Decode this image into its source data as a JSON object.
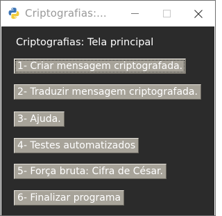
{
  "window": {
    "title": "Criptografias:...",
    "controls": {
      "minimize_icon": "minimize-icon",
      "maximize_icon": "maximize-icon",
      "close_icon": "close-icon"
    }
  },
  "main": {
    "heading": "Criptografias: Tela principal",
    "buttons": [
      {
        "label": "1- Criar mensagem criptografada."
      },
      {
        "label": "2- Traduzir mensagem criptografada."
      },
      {
        "label": "3- Ajuda."
      },
      {
        "label": "4- Testes automatizados"
      },
      {
        "label": "5- Força bruta: Cifra de César."
      },
      {
        "label": "6- Finalizar programa"
      }
    ]
  },
  "colors": {
    "background": "#2b2b2b",
    "button_face": "#a7a399",
    "text": "#ffffff",
    "titlebar_text": "#999999",
    "python_blue": "#3b74b6",
    "python_yellow": "#f2cc3c"
  }
}
